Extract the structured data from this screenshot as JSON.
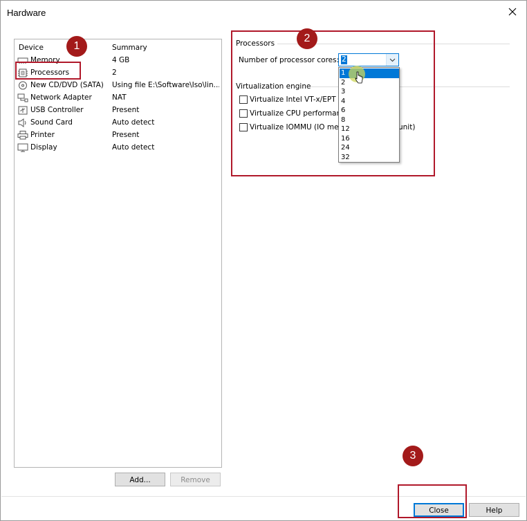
{
  "window": {
    "title": "Hardware"
  },
  "device_list": {
    "headers": {
      "device": "Device",
      "summary": "Summary"
    },
    "rows": [
      {
        "name": "Memory",
        "summary": "4 GB",
        "icon": "memory-icon"
      },
      {
        "name": "Processors",
        "summary": "2",
        "icon": "processor-icon"
      },
      {
        "name": "New CD/DVD (SATA)",
        "summary": "Using file E:\\Software\\Iso\\lin...",
        "icon": "cd-dvd-icon"
      },
      {
        "name": "Network Adapter",
        "summary": "NAT",
        "icon": "network-icon"
      },
      {
        "name": "USB Controller",
        "summary": "Present",
        "icon": "usb-icon"
      },
      {
        "name": "Sound Card",
        "summary": "Auto detect",
        "icon": "speaker-icon"
      },
      {
        "name": "Printer",
        "summary": "Present",
        "icon": "printer-icon"
      },
      {
        "name": "Display",
        "summary": "Auto detect",
        "icon": "monitor-icon"
      }
    ]
  },
  "buttons": {
    "add": "Add...",
    "remove": "Remove",
    "close": "Close",
    "help": "Help"
  },
  "processors": {
    "group_label": "Processors",
    "cores_label": "Number of processor cores:",
    "cores_value": "2",
    "options": [
      "1",
      "2",
      "3",
      "4",
      "6",
      "8",
      "12",
      "16",
      "24",
      "32"
    ]
  },
  "virtualization": {
    "group_label": "Virtualization engine",
    "options": [
      "Virtualize Intel VT-x/EPT o",
      "Virtualize CPU performanc",
      "Virtualize IOMMU (IO mem"
    ],
    "trailing_text": "unit)"
  },
  "annotations": [
    "1",
    "2",
    "3"
  ],
  "colors": {
    "accent": "#0078d7",
    "annotation": "#b0182a"
  }
}
